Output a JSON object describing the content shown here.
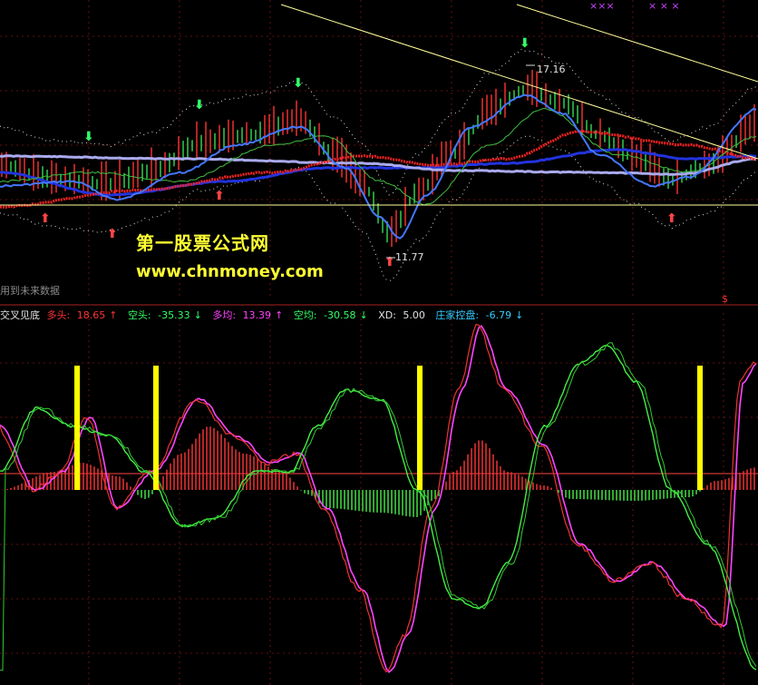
{
  "watermark": {
    "line1": "第一股票公式网",
    "line2": "www.chnmoney.com"
  },
  "notice": "用到未来数据",
  "upper_labels": {
    "high": "17.16",
    "low": "11.77"
  },
  "legend": {
    "title": "交叉见底",
    "items": [
      {
        "label": "多头:",
        "value": "18.65",
        "arrow": "↑",
        "color": "#ff3333"
      },
      {
        "label": "空头:",
        "value": "-35.33",
        "arrow": "↓",
        "color": "#33ff66"
      },
      {
        "label": "多均:",
        "value": "13.39",
        "arrow": "↑",
        "color": "#ff44ff"
      },
      {
        "label": "空均:",
        "value": "-30.58",
        "arrow": "↓",
        "color": "#33ff66"
      },
      {
        "label": "XD:",
        "value": "5.00",
        "arrow": "",
        "color": "#e0e0e0"
      },
      {
        "label": "庄家控盘:",
        "value": "-6.79",
        "arrow": "↓",
        "color": "#33ccff"
      }
    ]
  },
  "top_markers": {
    "left": "×××",
    "right": "× × ×",
    "s": "$"
  },
  "colors": {
    "red": "#ff3333",
    "green": "#33dd55",
    "yellow": "#ffff00",
    "blue": "#2233dd",
    "lavender": "#aaaaee",
    "magenta": "#ff44ff"
  },
  "chart_data": {
    "type": "line",
    "yellow_signal_bars": [
      4,
      8,
      22,
      37
    ]
  }
}
